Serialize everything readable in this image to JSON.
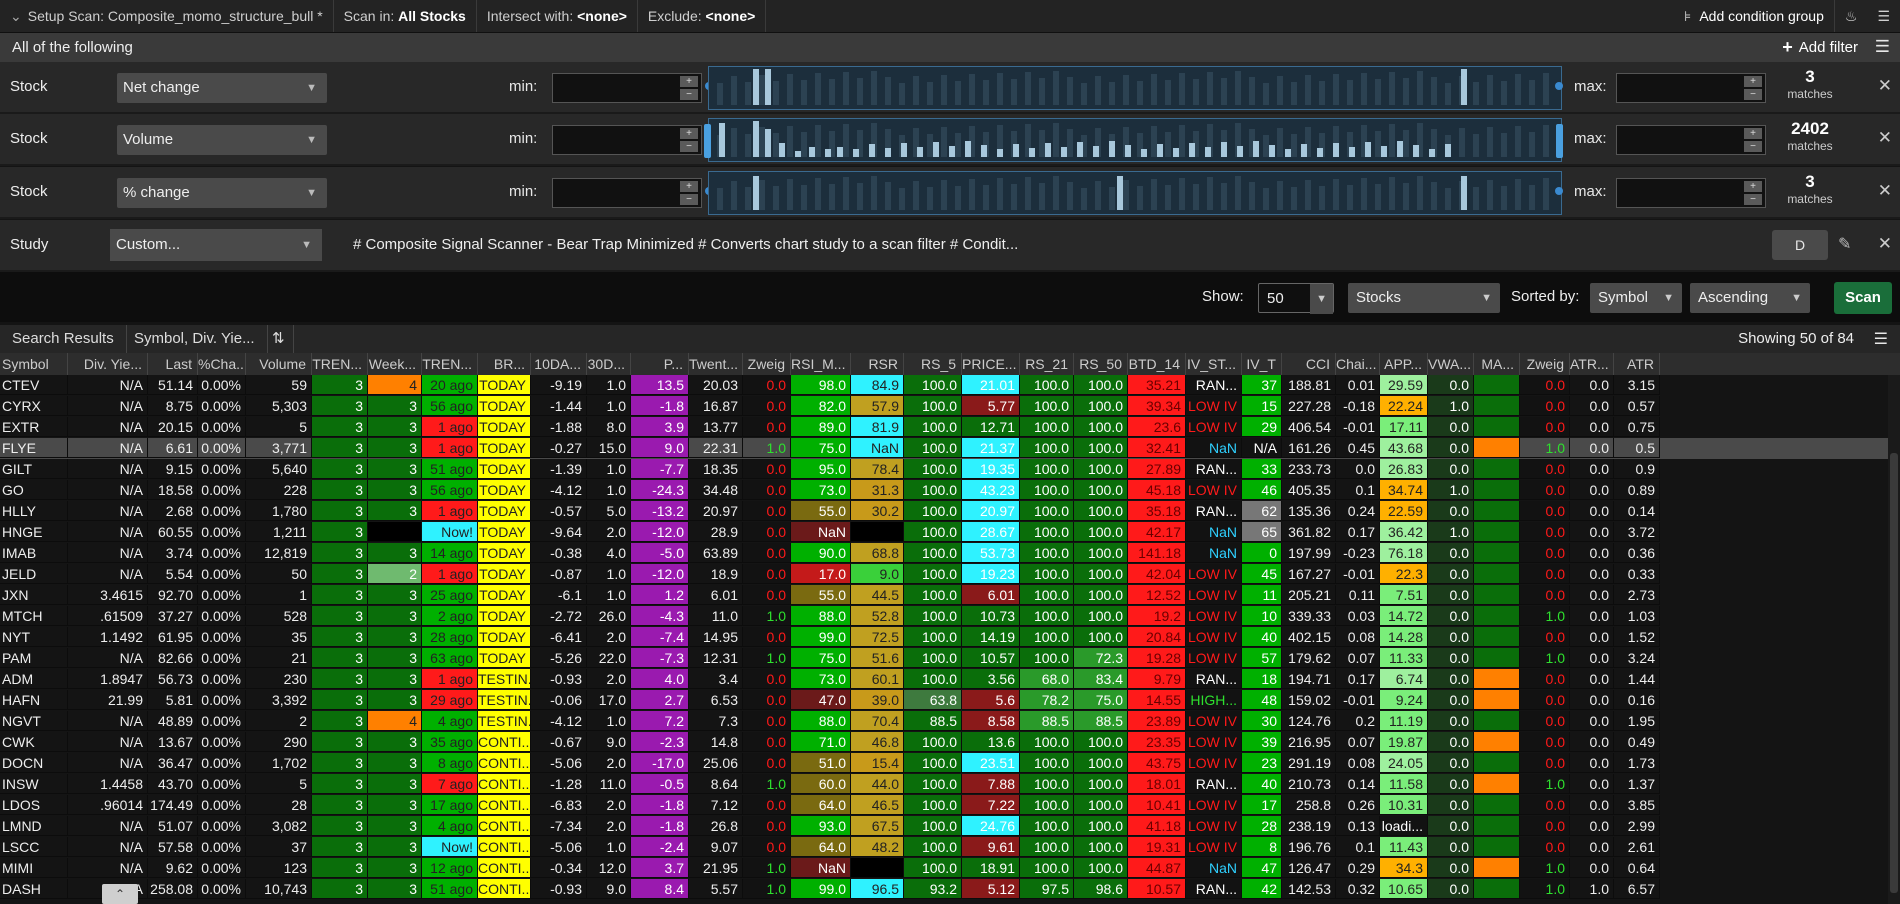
{
  "topbar": {
    "title": "Setup Scan: Composite_momo_structure_bull *",
    "scan_in_label": "Scan in:",
    "scan_in_value": "All Stocks",
    "intersect_label": "Intersect with:",
    "intersect_value": "<none>",
    "exclude_label": "Exclude:",
    "exclude_value": "<none>",
    "add_condition_group": "Add condition group"
  },
  "filter_header": {
    "title": "All of the following",
    "add_filter": "Add filter"
  },
  "filters": [
    {
      "label": "Stock",
      "field": "Net change",
      "min_label": "min:",
      "max_label": "max:",
      "matches": "3",
      "matches_label": "matches"
    },
    {
      "label": "Stock",
      "field": "Volume",
      "min_label": "min:",
      "max_label": "max:",
      "matches": "2402",
      "matches_label": "matches"
    },
    {
      "label": "Stock",
      "field": "% change",
      "min_label": "min:",
      "max_label": "max:",
      "matches": "3",
      "matches_label": "matches"
    }
  ],
  "study": {
    "label": "Study",
    "field": "Custom...",
    "text": "# Composite Signal Scanner - Bear Trap Minimized # Converts chart study to a scan filter # Condit...",
    "aggregation": "D"
  },
  "show_bar": {
    "show_label": "Show:",
    "show_value": "50",
    "type_value": "Stocks",
    "sorted_label": "Sorted by:",
    "sort_field": "Symbol",
    "sort_order": "Ascending",
    "scan_button": "Scan"
  },
  "tabs": {
    "search_results": "Search Results",
    "watchlist": "Symbol, Div. Yie...",
    "showing": "Showing 50 of 84"
  },
  "columns": [
    "Symbol",
    "Div. Yie...",
    "Last",
    "%Cha...",
    "Volume",
    "TREN...",
    "Week...",
    "TREN...",
    "BR...",
    "10DA...",
    "30D...",
    "P...",
    "Twent...",
    "Zweig",
    "RSI_M...",
    "RSR",
    "RS_5",
    "PRICE...",
    "RS_21",
    "RS_50",
    "BTD_14",
    "IV_ST...",
    "IV_T",
    "CCI",
    "Chai...",
    "APP...",
    "VWA...",
    "MA...",
    "Zweig",
    "ATR...",
    "ATR"
  ],
  "rows": [
    [
      "CTEV",
      "N/A",
      "51.14",
      "0.00%",
      "59",
      "3",
      "4",
      "20 ago",
      "TODAY",
      "-9.19",
      "1.0",
      "13.5",
      "20.03",
      "0.0",
      "98.0",
      "84.9",
      "100.0",
      "21.01",
      "100.0",
      "100.0",
      "35.21",
      "RAN...",
      "37",
      "188.81",
      "0.01",
      "29.59",
      "0.0",
      "",
      "0.0",
      "0.0",
      "3.15"
    ],
    [
      "CYRX",
      "N/A",
      "8.75",
      "0.00%",
      "5,303",
      "3",
      "3",
      "56 ago",
      "TODAY",
      "-1.44",
      "1.0",
      "-1.8",
      "16.87",
      "0.0",
      "82.0",
      "57.9",
      "100.0",
      "5.77",
      "100.0",
      "100.0",
      "39.34",
      "LOW IV",
      "15",
      "227.28",
      "-0.18",
      "22.24",
      "1.0",
      "",
      "0.0",
      "0.0",
      "0.57"
    ],
    [
      "EXTR",
      "N/A",
      "20.15",
      "0.00%",
      "5",
      "3",
      "3",
      "1 ago",
      "TODAY",
      "-1.88",
      "8.0",
      "3.9",
      "13.77",
      "0.0",
      "89.0",
      "81.9",
      "100.0",
      "12.71",
      "100.0",
      "100.0",
      "23.6",
      "LOW IV",
      "29",
      "406.54",
      "-0.01",
      "17.11",
      "0.0",
      "",
      "0.0",
      "0.0",
      "0.75"
    ],
    [
      "FLYE",
      "N/A",
      "6.61",
      "0.00%",
      "3,771",
      "3",
      "3",
      "1 ago",
      "TODAY",
      "-0.27",
      "15.0",
      "9.0",
      "22.31",
      "1.0",
      "75.0",
      "NaN",
      "100.0",
      "21.37",
      "100.0",
      "100.0",
      "32.41",
      "NaN",
      "N/A",
      "161.26",
      "0.45",
      "43.68",
      "0.0",
      "",
      "1.0",
      "0.0",
      "0.5"
    ],
    [
      "GILT",
      "N/A",
      "9.15",
      "0.00%",
      "5,640",
      "3",
      "3",
      "51 ago",
      "TODAY",
      "-1.39",
      "1.0",
      "-7.7",
      "18.35",
      "0.0",
      "95.0",
      "78.4",
      "100.0",
      "19.35",
      "100.0",
      "100.0",
      "27.89",
      "RAN...",
      "33",
      "233.73",
      "0.0",
      "26.83",
      "0.0",
      "",
      "0.0",
      "0.0",
      "0.9"
    ],
    [
      "GO",
      "N/A",
      "18.58",
      "0.00%",
      "228",
      "3",
      "3",
      "56 ago",
      "TODAY",
      "-4.12",
      "1.0",
      "-24.3",
      "34.48",
      "0.0",
      "73.0",
      "31.3",
      "100.0",
      "43.23",
      "100.0",
      "100.0",
      "45.18",
      "LOW IV",
      "46",
      "405.35",
      "0.1",
      "34.74",
      "1.0",
      "",
      "0.0",
      "0.0",
      "0.89"
    ],
    [
      "HLLY",
      "N/A",
      "2.68",
      "0.00%",
      "1,780",
      "3",
      "3",
      "1 ago",
      "TODAY",
      "-0.57",
      "5.0",
      "-13.2",
      "20.97",
      "0.0",
      "55.0",
      "30.2",
      "100.0",
      "20.97",
      "100.0",
      "100.0",
      "35.18",
      "RAN...",
      "62",
      "135.36",
      "0.24",
      "22.59",
      "0.0",
      "",
      "0.0",
      "0.0",
      "0.14"
    ],
    [
      "HNGE",
      "N/A",
      "60.55",
      "0.00%",
      "1,211",
      "3",
      "",
      "Now!",
      "TODAY",
      "-9.64",
      "2.0",
      "-12.0",
      "28.9",
      "0.0",
      "NaN",
      "",
      "100.0",
      "28.67",
      "100.0",
      "100.0",
      "42.17",
      "NaN",
      "65",
      "361.82",
      "0.17",
      "36.42",
      "1.0",
      "",
      "0.0",
      "0.0",
      "3.72"
    ],
    [
      "IMAB",
      "N/A",
      "3.74",
      "0.00%",
      "12,819",
      "3",
      "3",
      "14 ago",
      "TODAY",
      "-0.38",
      "4.0",
      "-5.0",
      "63.89",
      "0.0",
      "90.0",
      "68.8",
      "100.0",
      "53.73",
      "100.0",
      "100.0",
      "141.18",
      "NaN",
      "0",
      "197.99",
      "-0.23",
      "76.18",
      "0.0",
      "",
      "0.0",
      "0.0",
      "0.36"
    ],
    [
      "JELD",
      "N/A",
      "5.54",
      "0.00%",
      "50",
      "3",
      "2",
      "1 ago",
      "TODAY",
      "-0.87",
      "1.0",
      "-12.0",
      "18.9",
      "0.0",
      "17.0",
      "9.0",
      "100.0",
      "19.23",
      "100.0",
      "100.0",
      "42.04",
      "LOW IV",
      "45",
      "167.27",
      "-0.01",
      "22.3",
      "0.0",
      "",
      "0.0",
      "0.0",
      "0.33"
    ],
    [
      "JXN",
      "3.4615",
      "92.70",
      "0.00%",
      "1",
      "3",
      "3",
      "25 ago",
      "TODAY",
      "-6.1",
      "1.0",
      "1.2",
      "6.01",
      "0.0",
      "55.0",
      "44.5",
      "100.0",
      "6.01",
      "100.0",
      "100.0",
      "12.52",
      "LOW IV",
      "11",
      "205.21",
      "0.11",
      "7.51",
      "0.0",
      "",
      "0.0",
      "0.0",
      "2.73"
    ],
    [
      "MTCH",
      ".61509",
      "37.27",
      "0.00%",
      "528",
      "3",
      "3",
      "2 ago",
      "TODAY",
      "-2.72",
      "26.0",
      "-4.3",
      "11.0",
      "1.0",
      "88.0",
      "52.8",
      "100.0",
      "10.73",
      "100.0",
      "100.0",
      "19.2",
      "LOW IV",
      "10",
      "339.33",
      "0.03",
      "14.72",
      "0.0",
      "",
      "1.0",
      "0.0",
      "1.03"
    ],
    [
      "NYT",
      "1.1492",
      "61.95",
      "0.00%",
      "35",
      "3",
      "3",
      "28 ago",
      "TODAY",
      "-6.41",
      "2.0",
      "-7.4",
      "14.95",
      "0.0",
      "99.0",
      "72.5",
      "100.0",
      "14.19",
      "100.0",
      "100.0",
      "20.84",
      "LOW IV",
      "40",
      "402.15",
      "0.08",
      "14.28",
      "0.0",
      "",
      "0.0",
      "0.0",
      "1.52"
    ],
    [
      "PAM",
      "N/A",
      "82.66",
      "0.00%",
      "21",
      "3",
      "3",
      "63 ago",
      "TODAY",
      "-5.26",
      "22.0",
      "-7.3",
      "12.31",
      "1.0",
      "75.0",
      "51.6",
      "100.0",
      "10.57",
      "100.0",
      "72.3",
      "19.28",
      "LOW IV",
      "57",
      "179.62",
      "0.07",
      "11.33",
      "0.0",
      "",
      "1.0",
      "0.0",
      "3.24"
    ],
    [
      "ADM",
      "1.8947",
      "56.73",
      "0.00%",
      "230",
      "3",
      "3",
      "1 ago",
      "TESTIN...",
      "-0.93",
      "2.0",
      "4.0",
      "3.4",
      "0.0",
      "73.0",
      "60.1",
      "100.0",
      "3.56",
      "68.0",
      "83.4",
      "9.79",
      "RAN...",
      "18",
      "194.71",
      "0.17",
      "6.74",
      "0.0",
      "",
      "0.0",
      "0.0",
      "1.44"
    ],
    [
      "HAFN",
      "21.99",
      "5.81",
      "0.00%",
      "3,392",
      "3",
      "3",
      "29 ago",
      "TESTIN...",
      "-0.06",
      "17.0",
      "2.7",
      "6.53",
      "0.0",
      "47.0",
      "39.0",
      "63.8",
      "5.6",
      "78.2",
      "75.0",
      "14.55",
      "HIGH...",
      "48",
      "159.02",
      "-0.01",
      "9.24",
      "0.0",
      "",
      "0.0",
      "0.0",
      "0.16"
    ],
    [
      "NGVT",
      "N/A",
      "48.89",
      "0.00%",
      "2",
      "3",
      "4",
      "4 ago",
      "TESTIN...",
      "-4.12",
      "1.0",
      "7.2",
      "7.3",
      "0.0",
      "88.0",
      "70.4",
      "88.5",
      "8.58",
      "88.5",
      "88.5",
      "23.89",
      "LOW IV",
      "30",
      "124.76",
      "0.2",
      "11.19",
      "0.0",
      "",
      "0.0",
      "0.0",
      "1.95"
    ],
    [
      "CWK",
      "N/A",
      "13.67",
      "0.00%",
      "290",
      "3",
      "3",
      "35 ago",
      "CONTI...",
      "-0.67",
      "9.0",
      "-2.3",
      "14.8",
      "0.0",
      "71.0",
      "46.8",
      "100.0",
      "13.6",
      "100.0",
      "100.0",
      "23.35",
      "LOW IV",
      "39",
      "216.95",
      "0.07",
      "19.87",
      "0.0",
      "",
      "0.0",
      "0.0",
      "0.49"
    ],
    [
      "DOCN",
      "N/A",
      "36.47",
      "0.00%",
      "1,702",
      "3",
      "3",
      "8 ago",
      "CONTI...",
      "-5.06",
      "2.0",
      "-17.0",
      "25.06",
      "0.0",
      "51.0",
      "15.4",
      "100.0",
      "23.51",
      "100.0",
      "100.0",
      "43.75",
      "LOW IV",
      "23",
      "291.19",
      "0.08",
      "24.05",
      "0.0",
      "",
      "0.0",
      "0.0",
      "1.73"
    ],
    [
      "INSW",
      "1.4458",
      "43.70",
      "0.00%",
      "5",
      "3",
      "3",
      "7 ago",
      "CONTI...",
      "-1.28",
      "11.0",
      "-0.5",
      "8.64",
      "1.0",
      "60.0",
      "44.0",
      "100.0",
      "7.88",
      "100.0",
      "100.0",
      "18.01",
      "RAN...",
      "40",
      "210.73",
      "0.14",
      "11.58",
      "0.0",
      "",
      "1.0",
      "0.0",
      "1.37"
    ],
    [
      "LDOS",
      ".96014",
      "174.49",
      "0.00%",
      "28",
      "3",
      "3",
      "17 ago",
      "CONTI...",
      "-6.83",
      "2.0",
      "-1.8",
      "7.12",
      "0.0",
      "64.0",
      "46.5",
      "100.0",
      "7.22",
      "100.0",
      "100.0",
      "10.41",
      "LOW IV",
      "17",
      "258.8",
      "0.26",
      "10.31",
      "0.0",
      "",
      "0.0",
      "0.0",
      "3.85"
    ],
    [
      "LMND",
      "N/A",
      "51.07",
      "0.00%",
      "3,082",
      "3",
      "3",
      "4 ago",
      "CONTI...",
      "-7.34",
      "2.0",
      "-1.8",
      "26.8",
      "0.0",
      "93.0",
      "67.5",
      "100.0",
      "24.76",
      "100.0",
      "100.0",
      "41.18",
      "LOW IV",
      "28",
      "238.19",
      "0.13",
      "loadi...",
      "0.0",
      "",
      "0.0",
      "0.0",
      "2.99"
    ],
    [
      "LSCC",
      "N/A",
      "57.58",
      "0.00%",
      "37",
      "3",
      "3",
      "Now!",
      "CONTI...",
      "-5.06",
      "1.0",
      "-2.4",
      "9.07",
      "0.0",
      "64.0",
      "48.2",
      "100.0",
      "9.61",
      "100.0",
      "100.0",
      "19.31",
      "LOW IV",
      "8",
      "196.76",
      "0.1",
      "11.43",
      "0.0",
      "",
      "0.0",
      "0.0",
      "2.61"
    ],
    [
      "MIMI",
      "N/A",
      "9.62",
      "0.00%",
      "123",
      "3",
      "3",
      "12 ago",
      "CONTI...",
      "-0.34",
      "12.0",
      "3.7",
      "21.95",
      "1.0",
      "NaN",
      "",
      "100.0",
      "18.91",
      "100.0",
      "100.0",
      "44.87",
      "NaN",
      "47",
      "126.47",
      "0.29",
      "34.3",
      "0.0",
      "",
      "1.0",
      "0.0",
      "0.64"
    ],
    [
      "DASH",
      "N/A",
      "258.08",
      "0.00%",
      "10,743",
      "3",
      "3",
      "51 ago",
      "CONTI...",
      "-0.93",
      "9.0",
      "8.4",
      "5.57",
      "1.0",
      "99.0",
      "96.5",
      "93.2",
      "5.12",
      "97.5",
      "98.6",
      "10.57",
      "RAN...",
      "42",
      "142.53",
      "0.32",
      "10.65",
      "0.0",
      "",
      "1.0",
      "1.0",
      "6.57"
    ]
  ],
  "colors": {
    "accent_green": "#00b000",
    "dark_green": "#0a6e0a",
    "bright_green": "#2ee02e",
    "red": "#ff1a1a",
    "yellow": "#ffff00",
    "orange": "#ff8000",
    "cyan": "#2ff2ff",
    "purple": "#9a1aaf",
    "brown": "#6b1a1a"
  },
  "misc": {
    "collapse_icon": "chevron-up-icon"
  }
}
